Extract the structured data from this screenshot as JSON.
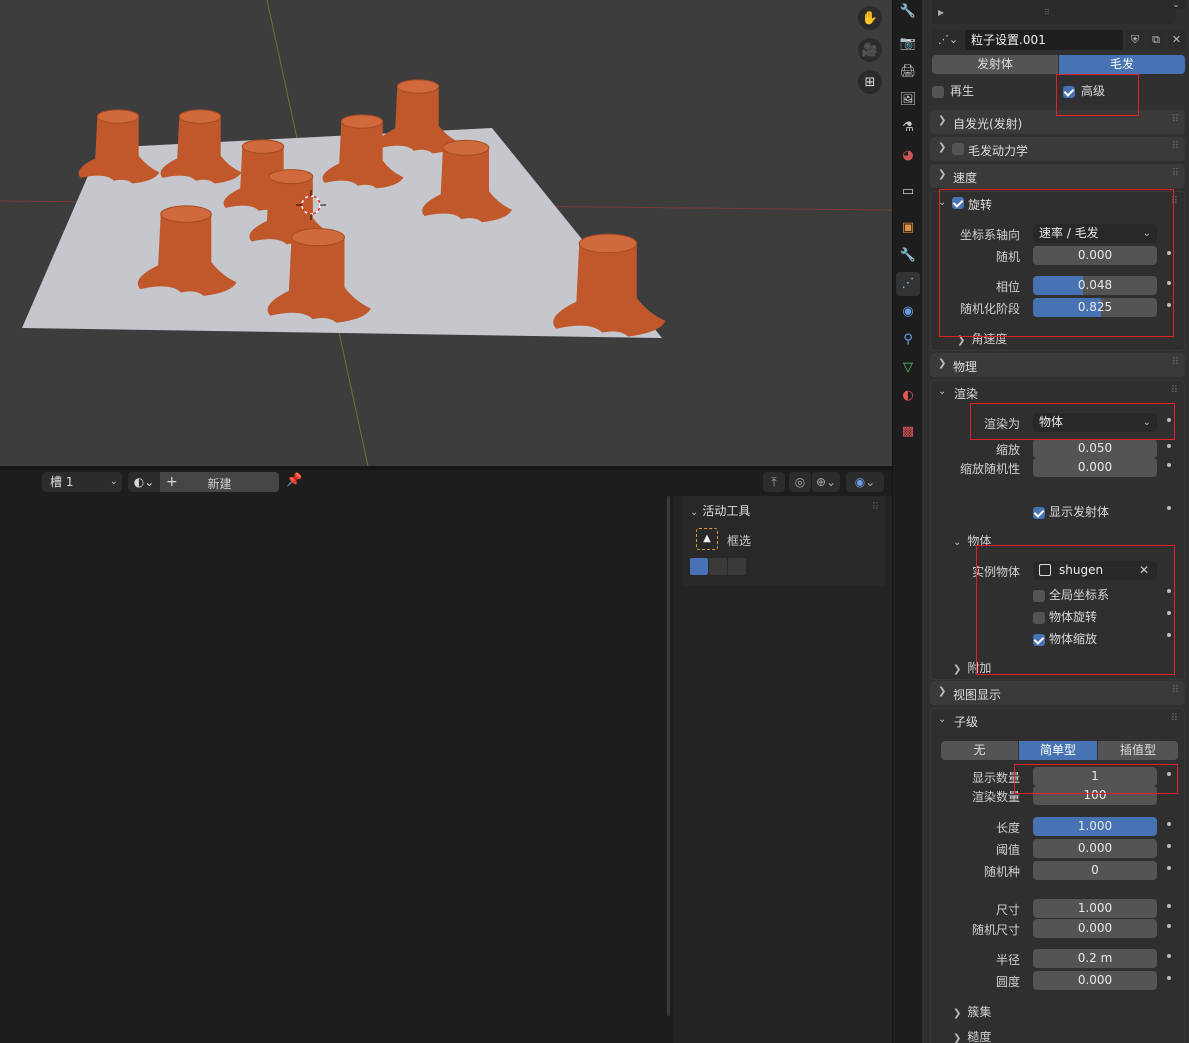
{
  "viewport": {
    "tools": [
      {
        "icon": "hand-icon",
        "glyph": "✋"
      },
      {
        "icon": "camera-icon",
        "glyph": "🎥"
      },
      {
        "icon": "grid-icon",
        "glyph": "⊞"
      }
    ]
  },
  "editor": {
    "slot": "槽 1",
    "new_label": "新建",
    "panel_title": "活动工具",
    "tool_label": "框选"
  },
  "props": {
    "datablock_name": "粒子设置.001",
    "type_tabs": [
      "发射体",
      "毛发"
    ],
    "regrow": "再生",
    "advanced": "高级",
    "emission": "自发光(发射)",
    "hair_dynamics": "毛发动力学",
    "velocity": "速度",
    "rotation": {
      "title": "旋转",
      "axis_label": "坐标系轴向",
      "axis_value": "速率 / 毛发",
      "random_label": "随机",
      "random_value": "0.000",
      "phase_label": "相位",
      "phase_value": "0.048",
      "phase_fill": 0.4,
      "rphase_label": "随机化阶段",
      "rphase_value": "0.825",
      "rphase_fill": 0.55,
      "angular": "角速度"
    },
    "physics": "物理",
    "render": {
      "title": "渲染",
      "render_as_label": "渲染为",
      "render_as_value": "物体",
      "scale_label": "缩放",
      "scale_value": "0.050",
      "scale_rand_label": "缩放随机性",
      "scale_rand_value": "0.000",
      "show_emitter": "显示发射体",
      "object_sub": "物体",
      "instance_label": "实例物体",
      "instance_value": "shugen",
      "global_coords": "全局坐标系",
      "obj_rotation": "物体旋转",
      "obj_scale": "物体缩放",
      "extra": "附加"
    },
    "viewport_display": "视图显示",
    "children": {
      "title": "子级",
      "modes": [
        "无",
        "简单型",
        "插值型"
      ],
      "display_amount_label": "显示数量",
      "display_amount_value": "1",
      "render_amount_label": "渲染数量",
      "render_amount_value": "100",
      "length_label": "长度",
      "length_value": "1.000",
      "threshold_label": "阈值",
      "threshold_value": "0.000",
      "seed_label": "随机种",
      "seed_value": "0",
      "size_label": "尺寸",
      "size_value": "1.000",
      "rand_size_label": "随机尺寸",
      "rand_size_value": "0.000",
      "radius_label": "半径",
      "radius_value": "0.2 m",
      "roundness_label": "圆度",
      "roundness_value": "0.000",
      "clumping": "簇集",
      "roughness": "糙度"
    }
  },
  "colors": {
    "accent": "#4772b3",
    "highlight_box": "#e0202a",
    "stump": "#c0582c",
    "plane": "#c5c7cd"
  }
}
